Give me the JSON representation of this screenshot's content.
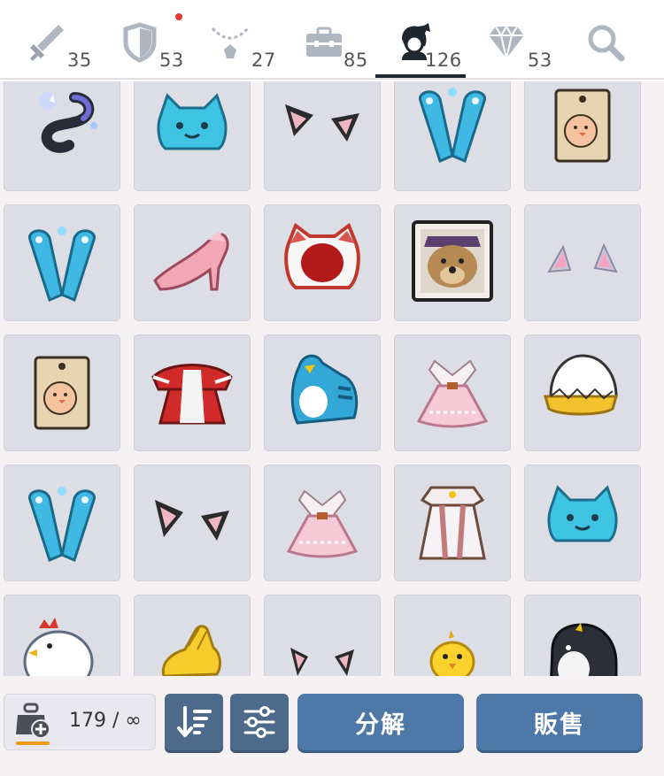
{
  "tabs": [
    {
      "key": "equip",
      "icon": "sword-icon",
      "count": "35"
    },
    {
      "key": "armor",
      "icon": "shield-icon",
      "count": "53"
    },
    {
      "key": "accessory",
      "icon": "necklace-icon",
      "count": "27"
    },
    {
      "key": "etc",
      "icon": "toolbox-icon",
      "count": "85"
    },
    {
      "key": "cosmetic",
      "icon": "character-icon",
      "count": "126",
      "selected": true
    },
    {
      "key": "gems",
      "icon": "diamond-icon",
      "count": "53"
    },
    {
      "key": "search",
      "icon": "search-icon",
      "count": ""
    }
  ],
  "colors": {
    "accent": "#4d78a7",
    "icon_button": "#4d6a8d",
    "cell_bg": "#dcdde5",
    "selected_underline": "#1e2630",
    "notification": "#e53935",
    "capacity_bar": "#f29b16"
  },
  "inventory": {
    "rows": [
      [
        "tail-icon",
        "cat-hat-icon",
        "cat-ears-icon",
        "paw-boots-icon",
        "chick-tag-icon"
      ],
      [
        "paw-boots-icon",
        "pink-heel-icon",
        "white-cat-hood-icon",
        "dog-portrait-icon",
        "pink-ears-icon"
      ],
      [
        "chick-tag-icon",
        "red-cape-outfit-icon",
        "penguin-suit-icon",
        "pink-dress-icon",
        "egg-shell-icon"
      ],
      [
        "paw-boots-icon",
        "cat-ears-icon",
        "pink-dress-icon",
        "white-robe-icon",
        "cat-hat-icon"
      ],
      [
        "chicken-suit-icon",
        "yellow-glove-icon",
        "cat-ears-icon",
        "yellow-chick-icon",
        "black-penguin-icon"
      ]
    ]
  },
  "bottom": {
    "capacity": "179 / ∞",
    "sort_icon": "sort-icon",
    "filter_icon": "filter-sliders-icon",
    "disassemble_label": "分解",
    "sell_label": "販售"
  }
}
